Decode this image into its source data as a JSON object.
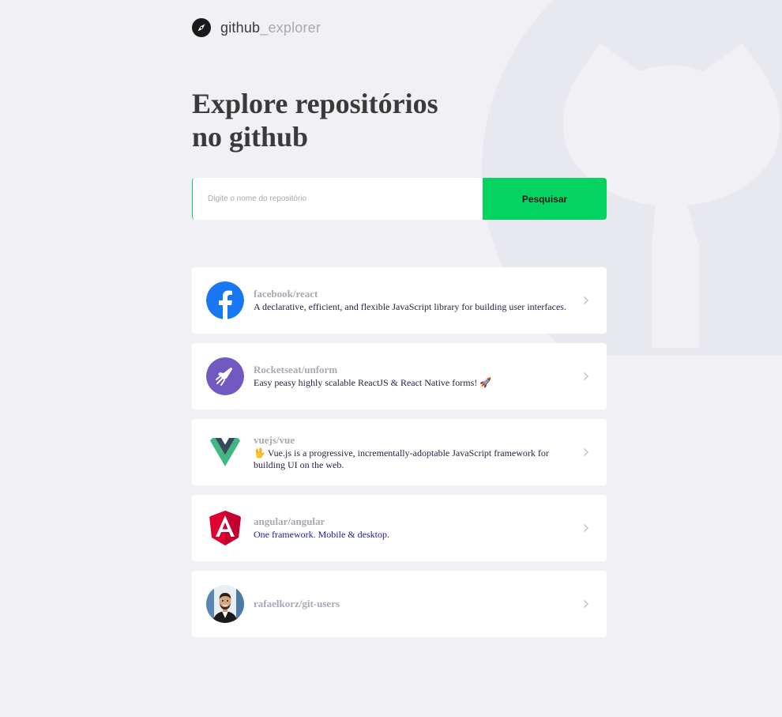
{
  "header": {
    "logo_primary": "github",
    "logo_secondary": "_explorer",
    "logo_icon": "compass-icon"
  },
  "title": {
    "line1": "Explore repositórios",
    "line2": "no github"
  },
  "search": {
    "placeholder": "Digite o nome do repositório",
    "value": "",
    "button_label": "Pesquisar"
  },
  "repositories": [
    {
      "name": "facebook/react",
      "description": "A declarative, efficient, and flexible JavaScript library for building user interfaces.",
      "avatar_icon": "facebook-logo-icon"
    },
    {
      "name": "Rocketseat/unform",
      "description": "Easy peasy highly scalable ReactJS & React Native forms! 🚀",
      "avatar_icon": "rocketseat-logo-icon"
    },
    {
      "name": "vuejs/vue",
      "description": "🖖 Vue.js is a progressive, incrementally-adoptable JavaScript framework for building UI on the web.",
      "avatar_icon": "vue-logo-icon"
    },
    {
      "name": "angular/angular",
      "description": "One framework. Mobile & desktop.",
      "avatar_icon": "angular-logo-icon"
    },
    {
      "name": "rafaelkorz/git-users",
      "description": "",
      "avatar_icon": "user-avatar-icon"
    }
  ],
  "colors": {
    "background": "#f0f0f5",
    "accent": "#04d361",
    "title": "#3a3a3a",
    "muted": "#a8a8b3"
  }
}
